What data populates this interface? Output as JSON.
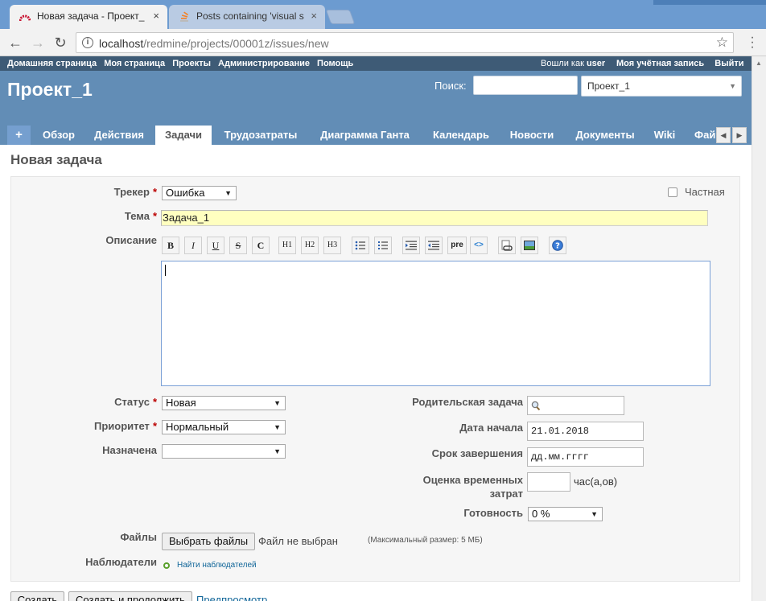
{
  "browser": {
    "tabs": [
      {
        "title": "Новая задача - Проект_"
      },
      {
        "title": "Posts containing 'visual s"
      }
    ],
    "url_host": "localhost",
    "url_path": "/redmine/projects/00001z/issues/new",
    "close_glyph": "×"
  },
  "topmenu": {
    "items": [
      "Домашняя страница",
      "Моя страница",
      "Проекты",
      "Администрирование",
      "Помощь"
    ],
    "logged_as_prefix": "Вошли как",
    "user": "user",
    "account": "Моя учётная запись",
    "logout": "Выйти"
  },
  "header": {
    "project_title": "Проект_1",
    "search_label": "Поиск:",
    "project_select": "Проект_1"
  },
  "mainmenu": {
    "plus": "+",
    "tabs": [
      "Обзор",
      "Действия",
      "Задачи",
      "Трудозатраты",
      "Диаграмма Ганта",
      "Календарь",
      "Новости",
      "Документы",
      "Wiki",
      "Фай"
    ],
    "selected": "Задачи"
  },
  "form": {
    "heading": "Новая задача",
    "tracker_label": "Трекер",
    "tracker_value": "Ошибка",
    "private_label": "Частная",
    "subject_label": "Тема",
    "subject_value": "Задача_1",
    "description_label": "Описание",
    "toolbar": [
      "B",
      "I",
      "U",
      "S",
      "C",
      "H1",
      "H2",
      "H3",
      "list-ul",
      "list-ol",
      "indent",
      "outdent",
      "pre",
      "<>",
      "link",
      "image",
      "help"
    ],
    "status_label": "Статус",
    "status_value": "Новая",
    "priority_label": "Приоритет",
    "priority_value": "Нормальный",
    "assignee_label": "Назначена",
    "assignee_value": "",
    "parent_label": "Родительская задача",
    "start_label": "Дата начала",
    "start_value": "21.01.2018",
    "due_label": "Срок завершения",
    "due_placeholder": "дд.мм.гггг",
    "estimate_label_1": "Оценка временных",
    "estimate_label_2": "затрат",
    "estimate_unit": "час(а,ов)",
    "done_label": "Готовность",
    "done_value": "0 %",
    "files_label": "Файлы",
    "choose_files": "Выбрать файлы",
    "no_file": "Файл не выбран",
    "max_size": "(Максимальный размер: 5 МБ)",
    "watchers_label": "Наблюдатели",
    "find_watchers": "Найти наблюдателей",
    "required_mark": "*"
  },
  "buttons": {
    "create": "Создать",
    "create_continue": "Создать и продолжить",
    "preview": "Предпросмотр"
  },
  "colors": {
    "tabstrip": "#6c9bd0",
    "topmenu": "#3e5b76",
    "header": "#628db6",
    "link": "#116699"
  }
}
